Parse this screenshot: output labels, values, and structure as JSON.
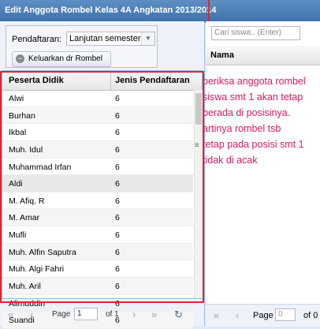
{
  "window": {
    "title": "Edit Anggota Rombel Kelas 4A Angkatan 2013/2014"
  },
  "filter": {
    "label": "Pendaftaran:",
    "value": "Lanjutan semester",
    "button_label": "Keluarkan dr Rombel"
  },
  "grid": {
    "columns": [
      "Peserta Didik",
      "Jenis Pendaftaran"
    ],
    "rows": [
      {
        "name": "Alwi",
        "jenis": "6"
      },
      {
        "name": "Burhan",
        "jenis": "6"
      },
      {
        "name": "Ikbal",
        "jenis": "6"
      },
      {
        "name": "Muh. Idul",
        "jenis": "6"
      },
      {
        "name": "Muhammad Irfan",
        "jenis": "6"
      },
      {
        "name": "Aldi",
        "jenis": "6"
      },
      {
        "name": "M. Afiq. R",
        "jenis": "6"
      },
      {
        "name": "M. Amar",
        "jenis": "6"
      },
      {
        "name": "Mufli",
        "jenis": "6"
      },
      {
        "name": "Muh. Alfin Saputra",
        "jenis": "6"
      },
      {
        "name": "Muh. Algi Fahri",
        "jenis": "6"
      },
      {
        "name": "Muh. Aril",
        "jenis": "6"
      },
      {
        "name": "Alimuddin",
        "jenis": "6"
      },
      {
        "name": "Suandi",
        "jenis": "6"
      }
    ]
  },
  "pager_left": {
    "page_label": "Page",
    "page_value": "1",
    "of_label": "of 1"
  },
  "right_panel": {
    "search_placeholder": "Cari siswa.. (Enter)",
    "column": "Nama",
    "page_label": "Page",
    "page_value": "0",
    "of_label": "of 0"
  },
  "note": "periksa anggota rombel\nsiswa smt 1 akan tetap\n berada di posisinya.\nartinya rombel tsb\ntetap pada posisi smt 1\ntidak di acak"
}
